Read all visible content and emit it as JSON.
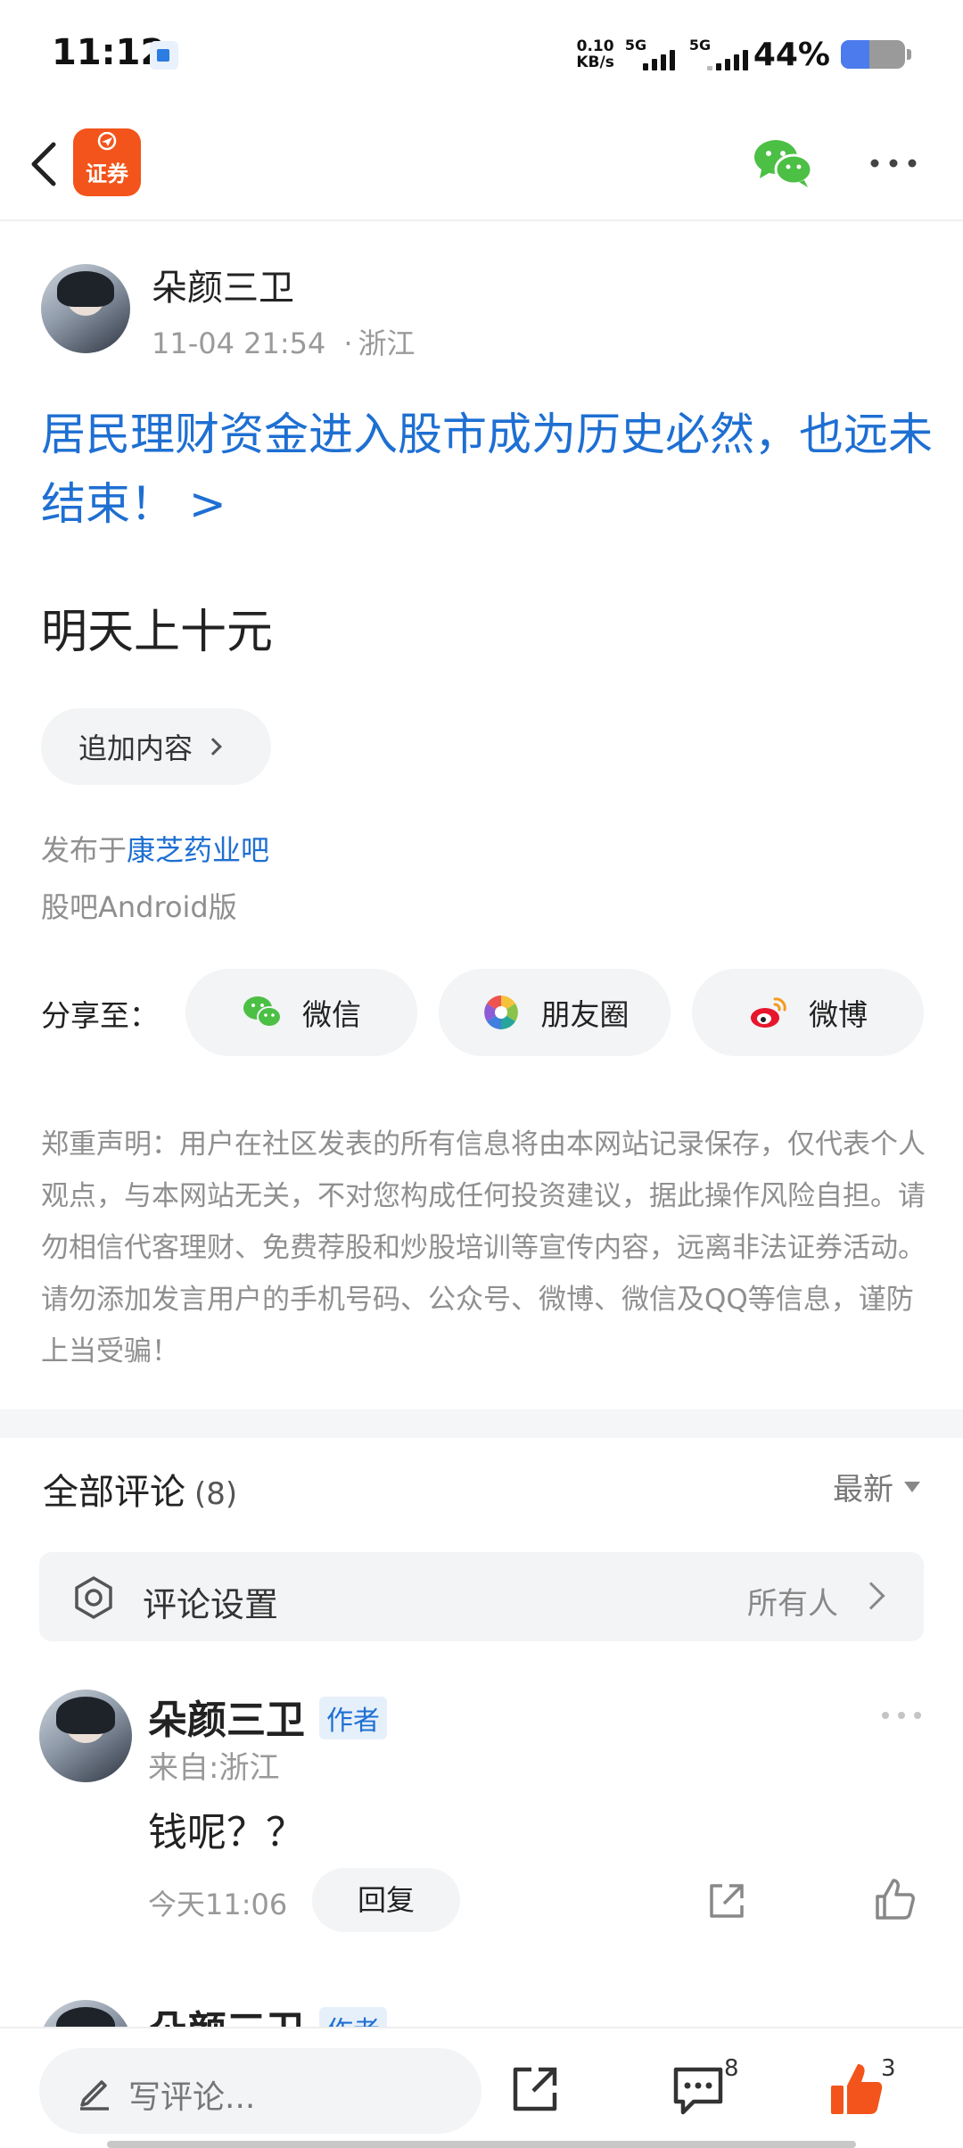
{
  "status_bar": {
    "time": "11:12",
    "net_speed_value": "0.10",
    "net_speed_unit": "KB/s",
    "sim1_label": "5G",
    "sim2_label": "5G",
    "battery_percent": "44%",
    "battery_level": 0.44
  },
  "nav": {
    "logo_text": "证券",
    "logo_color": "#f2541b",
    "wechat_icon": "wechat-icon",
    "more_icon": "more-icon"
  },
  "post": {
    "author": "朵颜三卫",
    "time": "11-04 21:54",
    "location": "浙江",
    "title": "居民理财资金进入股市成为历史必然，也远未结束！ >",
    "body": "明天上十元",
    "append_label": "追加内容",
    "published_prefix": "发布于",
    "published_bar": "康芝药业吧",
    "platform": "股吧Android版"
  },
  "share": {
    "label": "分享至：",
    "wechat": "微信",
    "moments": "朋友圈",
    "weibo": "微博"
  },
  "disclaimer": "郑重声明：用户在社区发表的所有信息将由本网站记录保存，仅代表个人观点，与本网站无关，不对您构成任何投资建议，据此操作风险自担。请勿相信代客理财、免费荐股和炒股培训等宣传内容，远离非法证券活动。请勿添加发言用户的手机号码、公众号、微博、微信及QQ等信息，谨防上当受骗！",
  "comments": {
    "title": "全部评论",
    "count": "(8)",
    "sort": "最新",
    "settings_label": "评论设置",
    "settings_value": "所有人",
    "items": [
      {
        "author": "朵颜三卫",
        "badge": "作者",
        "from": "来自:浙江",
        "text": "钱呢？？",
        "time": "今天11:06",
        "reply_label": "回复"
      },
      {
        "author": "朵颜三卫",
        "badge": "作者"
      }
    ]
  },
  "bottom_bar": {
    "write_placeholder": "写评论...",
    "comments_count": "8",
    "likes_count": "3",
    "like_color": "#f2541b"
  }
}
